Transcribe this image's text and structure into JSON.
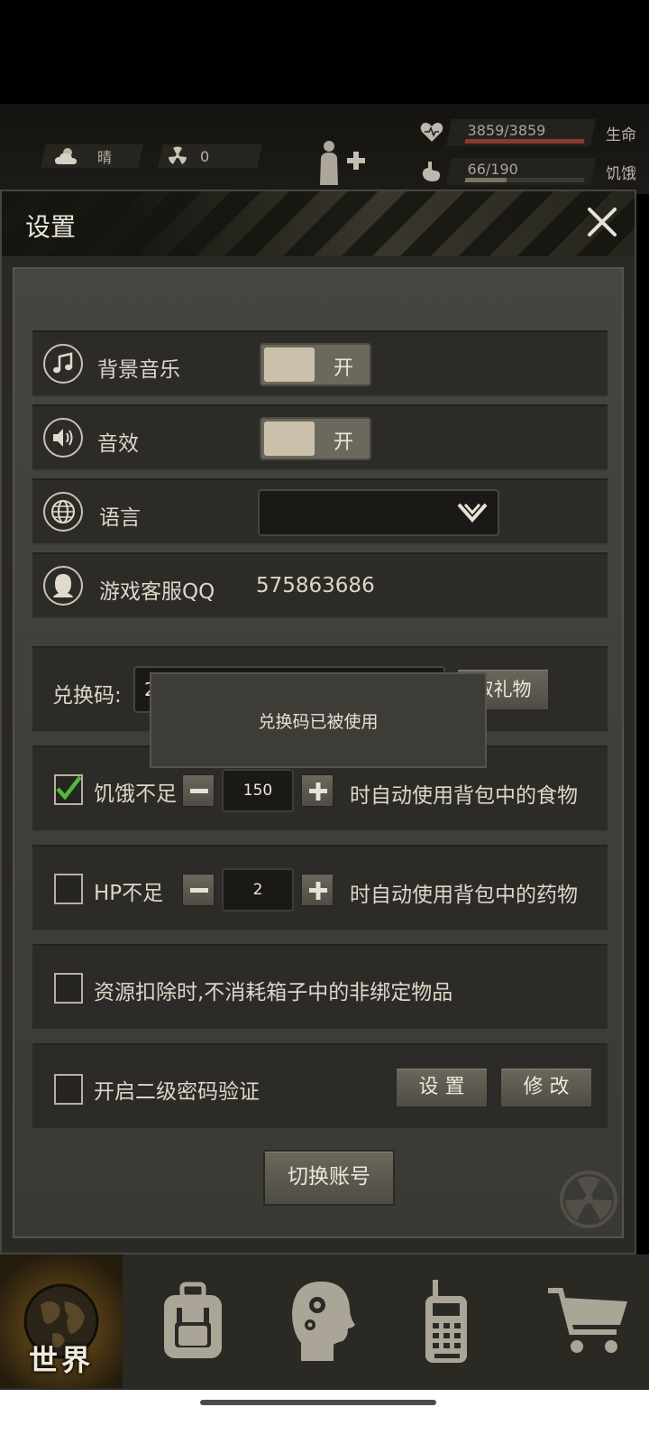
{
  "status_bar": {
    "weather_label": "晴",
    "radiation_value": "0",
    "hp_value": "3859/3859",
    "hp_label": "生命",
    "hp_fraction": 1.0,
    "hunger_value": "66/190",
    "hunger_label": "饥饿",
    "hunger_fraction": 0.35,
    "colors": {
      "hp": "#8a3a31",
      "hunger": "#7a7466"
    }
  },
  "dialog": {
    "title": "设置",
    "music": {
      "label": "背景音乐",
      "state": "开",
      "icon": "music-note-icon"
    },
    "sound": {
      "label": "音效",
      "state": "开",
      "icon": "speaker-icon"
    },
    "language": {
      "label": "语言",
      "selected": "",
      "icon": "globe-icon"
    },
    "support": {
      "label": "游戏客服QQ",
      "value": "575863686",
      "icon": "support-icon"
    },
    "redeem": {
      "label": "兑换码:",
      "input_value": "2",
      "button_label": "领取礼物",
      "button_visible": "取礼物"
    },
    "auto_food": {
      "checked": true,
      "label": "饥饿不足",
      "value": "150",
      "suffix": "时自动使用背包中的食物"
    },
    "auto_med": {
      "checked": false,
      "label": "HP不足",
      "value": "2",
      "suffix": "时自动使用背包中的药物"
    },
    "resource_option": {
      "checked": false,
      "label": "资源扣除时,不消耗箱子中的非绑定物品"
    },
    "second_password": {
      "checked": false,
      "label": "开启二级密码验证",
      "set_label": "设 置",
      "modify_label": "修 改"
    },
    "switch_account_label": "切换账号"
  },
  "toast": {
    "message": "兑换码已被使用"
  },
  "bottom_nav": {
    "items": [
      {
        "label": "世界",
        "icon": "globe-icon",
        "active": true
      },
      {
        "label": "",
        "icon": "backpack-icon",
        "active": false
      },
      {
        "label": "",
        "icon": "head-gears-icon",
        "active": false
      },
      {
        "label": "",
        "icon": "radio-icon",
        "active": false
      },
      {
        "label": "",
        "icon": "cart-icon",
        "active": false
      }
    ]
  }
}
